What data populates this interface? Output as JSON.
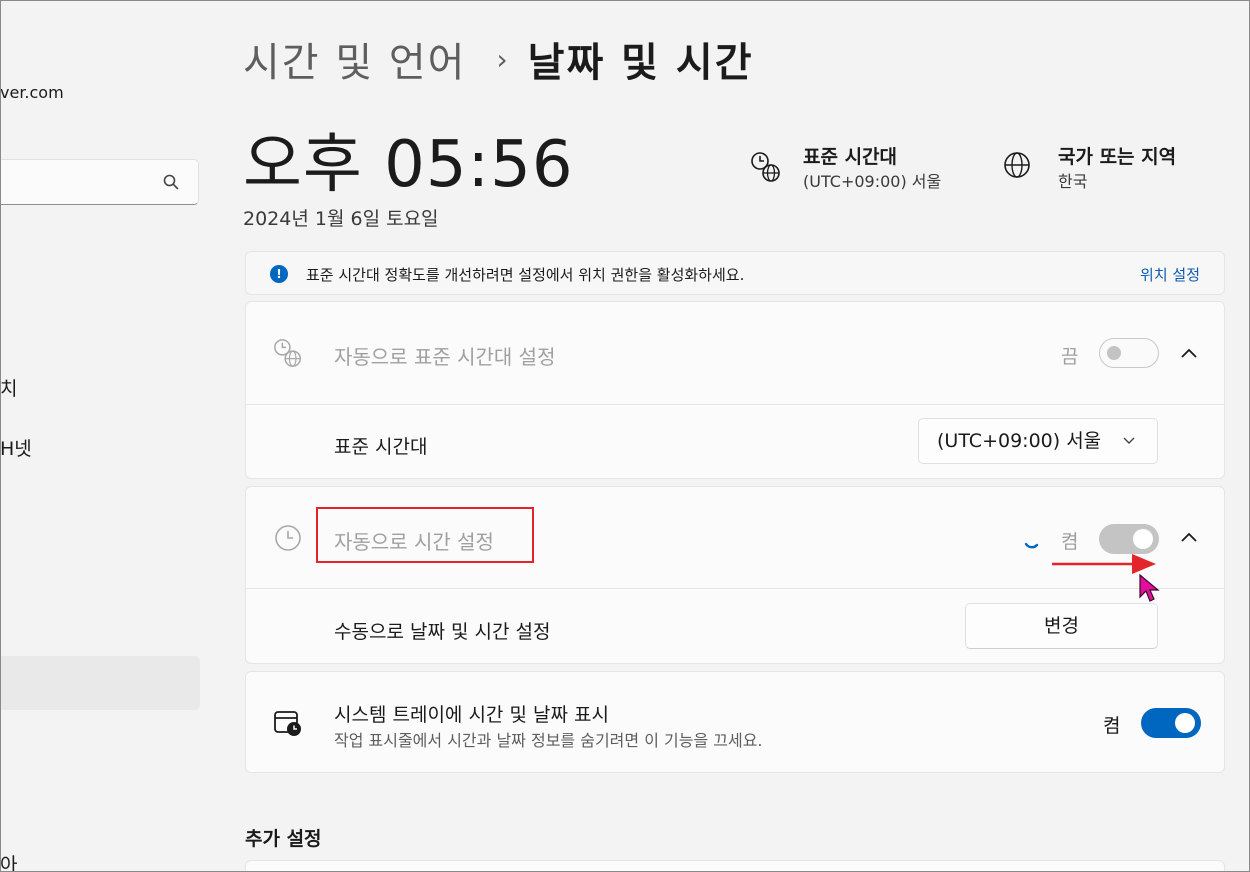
{
  "sidebar": {
    "email_fragment": "ver.com",
    "items": [
      {
        "label": "치"
      },
      {
        "label": "H넷"
      },
      {
        "label": "아"
      }
    ]
  },
  "header": {
    "breadcrumb_parent": "시간 및 언어",
    "breadcrumb_separator": "›",
    "page_title": "날짜 및 시간"
  },
  "clock": {
    "time": "오후 05:56",
    "date": "2024년 1월 6일 토요일"
  },
  "timezone_info": {
    "title": "표준 시간대",
    "value": "(UTC+09:00) 서울"
  },
  "region_info": {
    "title": "국가 또는 지역",
    "value": "한국"
  },
  "notice": {
    "message": "표준 시간대 정확도를 개선하려면 설정에서 위치 권한을 활성화하세요.",
    "link": "위치 설정"
  },
  "auto_timezone": {
    "label": "자동으로 표준 시간대 설정",
    "state": "끔",
    "sub_label": "표준 시간대",
    "dropdown_value": "(UTC+09:00) 서울"
  },
  "auto_time": {
    "label": "자동으로 시간 설정",
    "state": "켬",
    "manual_label": "수동으로 날짜 및 시간 설정",
    "change_button": "변경"
  },
  "tray": {
    "title": "시스템 트레이에 시간 및 날짜 표시",
    "subtitle": "작업 표시줄에서 시간과 날짜 정보를 숨기려면 이 기능을 끄세요.",
    "state": "켬"
  },
  "additional": {
    "title": "추가 설정"
  },
  "colors": {
    "accent": "#0067c0",
    "annotation": "#e3242b",
    "cursor": "#e0109b"
  }
}
